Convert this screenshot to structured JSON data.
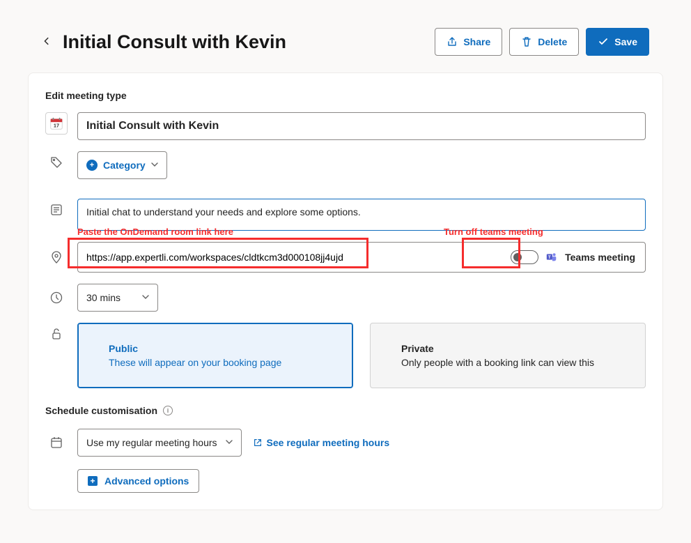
{
  "header": {
    "title": "Initial Consult with Kevin",
    "share_label": "Share",
    "delete_label": "Delete",
    "save_label": "Save"
  },
  "form": {
    "section_label": "Edit meeting type",
    "title_value": "Initial Consult with Kevin",
    "category_label": "Category",
    "description_value": "Initial chat to understand your needs and explore some options.",
    "location_value": "https://app.expertli.com/workspaces/cldtkcm3d000108jj4ujd",
    "teams_label": "Teams meeting",
    "duration_value": "30 mins",
    "visibility": {
      "public_title": "Public",
      "public_desc": "These will appear on your booking page",
      "private_title": "Private",
      "private_desc": "Only people with a booking link can view this"
    },
    "schedule": {
      "label": "Schedule customisation",
      "hours_dropdown": "Use my regular meeting hours",
      "see_hours_link": "See regular meeting hours",
      "advanced_label": "Advanced options"
    }
  },
  "annotations": {
    "paste_link": "Paste the OnDemand room link here",
    "turn_off_teams": "Turn off teams meeting"
  }
}
